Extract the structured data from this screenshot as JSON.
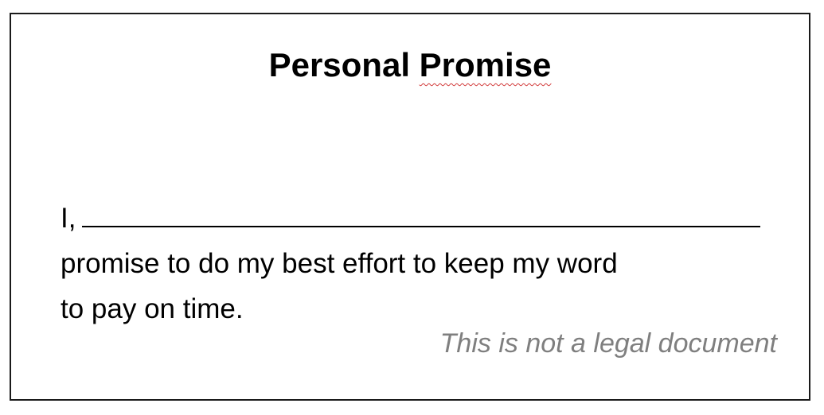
{
  "document": {
    "title_word1": "Personal",
    "title_word2": "Promise",
    "line1_prefix": "I,",
    "line2": "promise to do my best effort to keep my word",
    "line3": "to pay on time.",
    "disclaimer": "This is not a legal document"
  },
  "colors": {
    "border": "#1a1a1a",
    "text": "#000000",
    "disclaimer": "#7f7f7f",
    "spellcheck": "#d23a3a"
  }
}
